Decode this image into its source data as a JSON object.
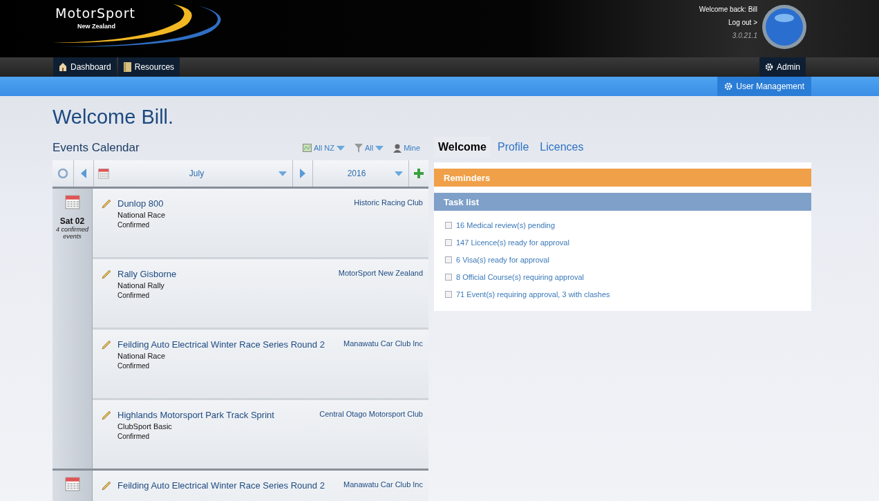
{
  "header": {
    "logo": {
      "name": "MotorSport",
      "region": "New Zealand"
    },
    "welcome": "Welcome back: Bill",
    "logout": "Log out >",
    "version": "3.0.21.1"
  },
  "nav": {
    "items": [
      {
        "label": "Dashboard"
      },
      {
        "label": "Resources"
      }
    ],
    "admin": "Admin"
  },
  "subnav": {
    "items": [
      {
        "label": "User Management"
      }
    ]
  },
  "page_title": "Welcome Bill.",
  "calendar": {
    "title": "Events Calendar",
    "filters": [
      {
        "label": "All NZ",
        "dropdown": true
      },
      {
        "label": "All",
        "dropdown": true
      },
      {
        "label": "Mine",
        "dropdown": false
      }
    ],
    "month": "July",
    "year": "2016",
    "days": [
      {
        "date": "Sat 02",
        "summary": "4 confirmed events",
        "events": [
          {
            "title": "Dunlop 800",
            "type": "National Race",
            "status": "Confirmed",
            "club": "Historic Racing Club"
          },
          {
            "title": "Rally Gisborne",
            "type": "National Rally",
            "status": "Confirmed",
            "club": "MotorSport New Zealand"
          },
          {
            "title": "Feilding Auto Electrical Winter Race Series Round 2",
            "type": "National Race",
            "status": "Confirmed",
            "club": "Manawatu Car Club Inc"
          },
          {
            "title": "Highlands Motorsport Park Track Sprint",
            "type": "ClubSport Basic",
            "status": "Confirmed",
            "club": "Central Otago Motorsport Club"
          }
        ]
      },
      {
        "events": [
          {
            "title": "Feilding Auto Electrical Winter Race Series Round 2",
            "club": "Manawatu Car Club Inc"
          }
        ]
      }
    ]
  },
  "tabs": [
    {
      "label": "Welcome",
      "selected": true
    },
    {
      "label": "Profile",
      "selected": false
    },
    {
      "label": "Licences",
      "selected": false
    }
  ],
  "reminders": {
    "title": "Reminders"
  },
  "task_list": {
    "title": "Task list",
    "items": [
      {
        "label": "16 Medical review(s) pending",
        "checked": false
      },
      {
        "label": "147 Licence(s) ready for approval",
        "checked": false
      },
      {
        "label": "6 Visa(s) ready for approval",
        "checked": false
      },
      {
        "label": "8 Official Course(s) requiring approval",
        "checked": false
      },
      {
        "label": "71 Event(s) requiring approval, 3 with clashes",
        "checked": false
      }
    ]
  }
}
